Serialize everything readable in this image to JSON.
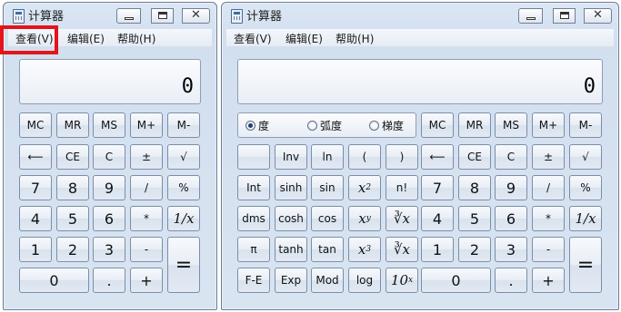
{
  "left_window": {
    "title": "计算器",
    "menu": [
      "查看(V)",
      "编辑(E)",
      "帮助(H)"
    ],
    "display_value": "0",
    "buttons": {
      "mc": "MC",
      "mr": "MR",
      "ms": "MS",
      "mplus": "M+",
      "mminus": "M-",
      "back": "⟵",
      "ce": "CE",
      "c": "C",
      "pm": "±",
      "sqrt": "√",
      "n7": "7",
      "n8": "8",
      "n9": "9",
      "div": "/",
      "pct": "%",
      "n4": "4",
      "n5": "5",
      "n6": "6",
      "mul": "*",
      "recip": "1/x",
      "n1": "1",
      "n2": "2",
      "n3": "3",
      "sub": "-",
      "eq": "=",
      "n0": "0",
      "dot": ".",
      "add": "+"
    }
  },
  "right_window": {
    "title": "计算器",
    "menu": [
      "查看(V)",
      "编辑(E)",
      "帮助(H)"
    ],
    "display_value": "0",
    "angle_modes": [
      "度",
      "弧度",
      "梯度"
    ],
    "selected_mode": "度",
    "sci_buttons": {
      "inv": "Inv",
      "ln": "ln",
      "lp": "(",
      "rp": ")",
      "int": "Int",
      "sinh": "sinh",
      "sin": "sin",
      "x2_base": "x",
      "x2_exp": "2",
      "fact": "n!",
      "dms": "dms",
      "cosh": "cosh",
      "cos": "cos",
      "xy_base": "x",
      "xy_exp": "y",
      "yroot": "∛x",
      "pi": "π",
      "tanh": "tanh",
      "tan": "tan",
      "x3_base": "x",
      "x3_exp": "3",
      "cbrt": "∛x",
      "fe": "F-E",
      "exp": "Exp",
      "mod": "Mod",
      "log": "log",
      "tenx_base": "10",
      "tenx_exp": "x"
    },
    "buttons": {
      "mc": "MC",
      "mr": "MR",
      "ms": "MS",
      "mplus": "M+",
      "mminus": "M-",
      "back": "⟵",
      "ce": "CE",
      "c": "C",
      "pm": "±",
      "sqrt": "√",
      "n7": "7",
      "n8": "8",
      "n9": "9",
      "div": "/",
      "pct": "%",
      "n4": "4",
      "n5": "5",
      "n6": "6",
      "mul": "*",
      "recip": "1/x",
      "n1": "1",
      "n2": "2",
      "n3": "3",
      "sub": "-",
      "eq": "=",
      "n0": "0",
      "dot": ".",
      "add": "+"
    }
  },
  "colors": {
    "highlight": "#e3141b",
    "window_bg": "#d9e4f1"
  }
}
